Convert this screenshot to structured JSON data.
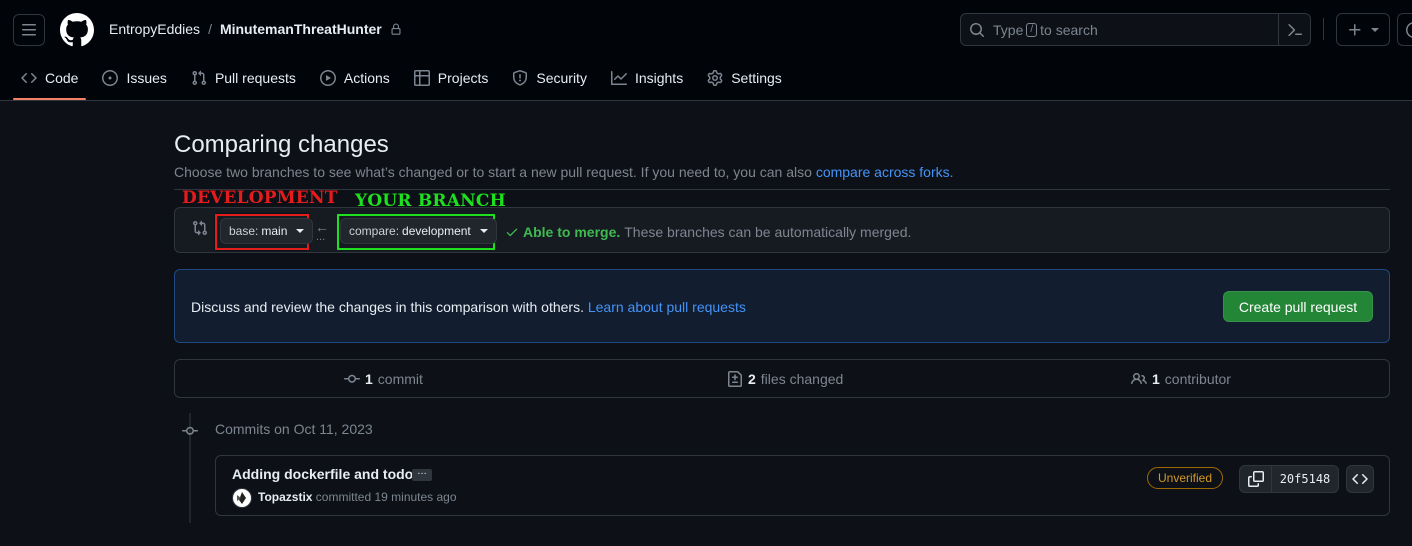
{
  "header": {
    "owner": "EntropyEddies",
    "separator": "/",
    "repo": "MinutemanThreatHunter",
    "search_prefix": "Type",
    "search_key": "/",
    "search_suffix": "to search",
    "icons": [
      "hamburger-icon",
      "github-logo-icon",
      "lock-icon",
      "search-icon",
      "command-palette-icon",
      "plus-icon",
      "issue-icon"
    ]
  },
  "tabs": [
    {
      "label": "Code",
      "icon": "code-icon",
      "active": true
    },
    {
      "label": "Issues",
      "icon": "issue-icon"
    },
    {
      "label": "Pull requests",
      "icon": "pull-request-icon"
    },
    {
      "label": "Actions",
      "icon": "play-icon"
    },
    {
      "label": "Projects",
      "icon": "table-icon"
    },
    {
      "label": "Security",
      "icon": "shield-icon"
    },
    {
      "label": "Insights",
      "icon": "graph-icon"
    },
    {
      "label": "Settings",
      "icon": "gear-icon"
    }
  ],
  "main": {
    "title": "Comparing changes",
    "subtitle": "Choose two branches to see what’s changed or to start a new pull request. If you need to, you can also",
    "subtitle_link": "compare across forks",
    "subtitle_end": "."
  },
  "annotations": {
    "base_label": "DEVELOPMENT",
    "compare_label": "YOUR BRANCH",
    "base_color": "#e51c1c",
    "compare_color": "#1ee01e"
  },
  "range": {
    "base_prefix": "base:",
    "base_value": "main",
    "arrow": "←",
    "dots": "...",
    "compare_prefix": "compare:",
    "compare_value": "development",
    "merge_ok": "Able to merge.",
    "merge_text": "These branches can be automatically merged."
  },
  "flash": {
    "text": "Discuss and review the changes in this comparison with others.",
    "link": "Learn about pull requests",
    "button": "Create pull request"
  },
  "stats": {
    "commits_count": "1",
    "commits_label": "commit",
    "files_count": "2",
    "files_label": "files changed",
    "contributors_count": "1",
    "contributors_label": "contributor"
  },
  "commits": {
    "date_label": "Commits on Oct 11, 2023",
    "items": [
      {
        "title": "Adding dockerfile and todo",
        "ellipsis": "…",
        "author": "Topazstix",
        "meta": "committed 19 minutes ago",
        "badge": "Unverified",
        "sha": "20f5148"
      }
    ]
  },
  "colors": {
    "accent_link": "#4493f8",
    "success": "#3fb950",
    "primary_button": "#238636",
    "warning": "#d29922",
    "active_tab_underline": "#f78166"
  }
}
